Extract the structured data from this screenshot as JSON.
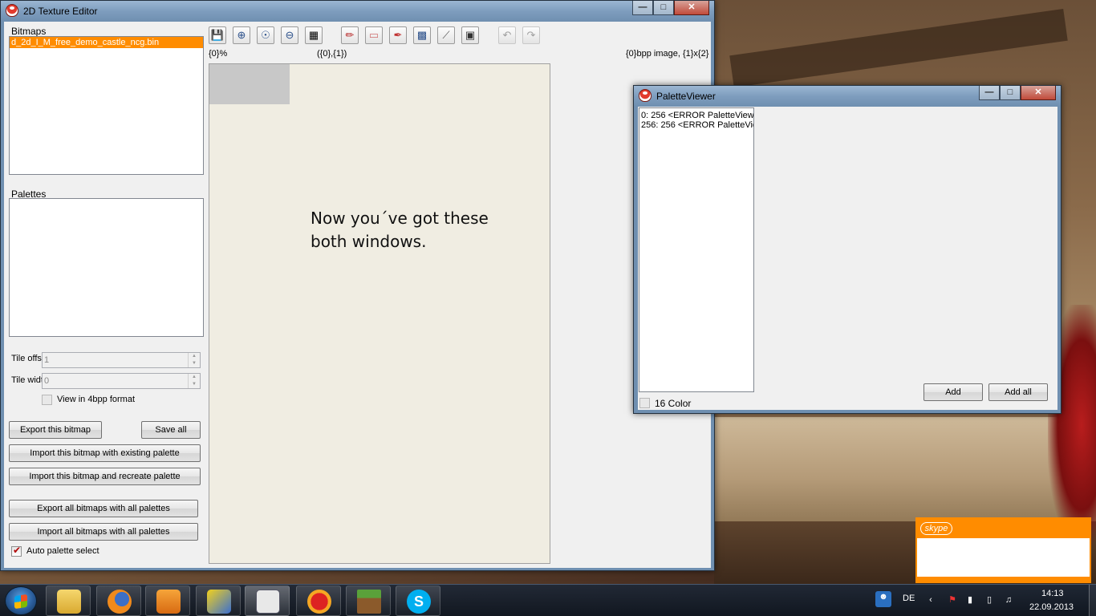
{
  "main_window": {
    "title": "2D Texture Editor",
    "bitmaps_label": "Bitmaps",
    "bitmaps": [
      "d_2d_I_M_free_demo_castle_ncg.bin"
    ],
    "palettes_label": "Palettes",
    "tile_offset_label": "Tile offse",
    "tile_offset_value": "1",
    "tile_width_label": "Tile widt",
    "tile_width_value": "0",
    "view_4bpp_label": "View in 4bpp format",
    "export_bitmap": "Export this bitmap",
    "save_all": "Save all",
    "import_existing": "Import this bitmap with existing palette",
    "import_recreate": "Import this bitmap and recreate palette",
    "export_all": "Export all bitmaps with all palettes",
    "import_all": "Import all bitmaps with all palettes",
    "auto_palette": "Auto palette select",
    "zoom_text": "{0}%",
    "coords_text": "({0},{1})",
    "image_info": "{0}bpp image, {1}x{2}",
    "canvas_note": "Now you´ve got these both windows."
  },
  "palette_window": {
    "title": "PaletteViewer",
    "items": [
      "0: 256 <ERROR PaletteViewer",
      "256: 256 <ERROR PaletteViewer"
    ],
    "color16_label": "16 Color",
    "add": "Add",
    "add_all": "Add all"
  },
  "skype": {
    "logo": "skype"
  },
  "taskbar": {
    "language": "DE",
    "time": "14:13",
    "date": "22.09.2013"
  },
  "colors": {
    "selection": "#ff8c00",
    "canvas": "#f0ede2",
    "skype": "#ff8c00"
  }
}
